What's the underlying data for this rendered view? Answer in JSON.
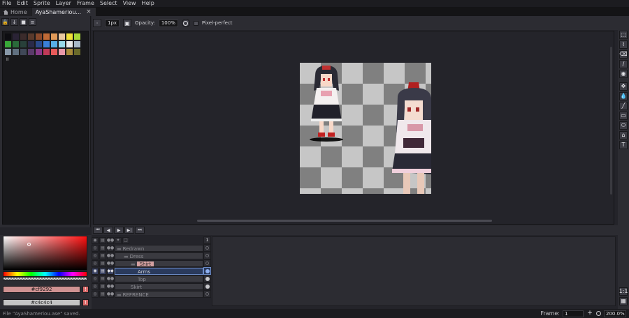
{
  "menu": [
    "File",
    "Edit",
    "Sprite",
    "Layer",
    "Frame",
    "Select",
    "View",
    "Help"
  ],
  "tabs": [
    {
      "label": "Home",
      "icon": "home-icon"
    },
    {
      "label": "AyaShameriou...",
      "close": "×"
    }
  ],
  "palette": {
    "colors": [
      "#0d0d11",
      "#2a2335",
      "#3b2b2b",
      "#5a3a2c",
      "#8a4a2c",
      "#c06a36",
      "#e09a58",
      "#e8c8a0",
      "#f0e038",
      "#a8d838",
      "#38a838",
      "#2a6a3a",
      "#28403a",
      "#2a2a48",
      "#2a4a8a",
      "#3a80d8",
      "#58b0e8",
      "#98d8e8",
      "#e8e8e8",
      "#a8b8c8",
      "#8898a8",
      "#607080",
      "#404858",
      "#5a3a6a",
      "#8a3a8a",
      "#c03a58",
      "#e85a5a",
      "#e898a8",
      "#a88a3a",
      "#6a6a2a"
    ],
    "extra_label": "II"
  },
  "context": {
    "brush_size": "1px",
    "opacity_label": "Opacity:",
    "opacity_value": "100%",
    "pixel_perfect_label": "Pixel-perfect"
  },
  "tools": [
    "⬚",
    "⌇",
    "⌫",
    "∕",
    "◉",
    "✥",
    "💧",
    "╱",
    "▭",
    "⬭",
    "⌂",
    "T"
  ],
  "tool_names": [
    "rectangular-marquee-icon",
    "lasso-icon",
    "eraser-icon",
    "pencil-icon",
    "spray-icon",
    "move-icon",
    "eyedropper-icon",
    "line-icon",
    "rectangle-icon",
    "ellipse-icon",
    "blur-icon",
    "text-icon"
  ],
  "timeline": {
    "buttons": [
      "⏮",
      "◀",
      "▶",
      "▶|",
      "⏭"
    ],
    "frame_header": "1"
  },
  "layers": [
    {
      "name": "Redrawn",
      "indent": 0,
      "type": "group",
      "cel": "empty"
    },
    {
      "name": "Dress",
      "indent": 10,
      "type": "group",
      "cel": "empty"
    },
    {
      "name": "Shirt",
      "indent": 20,
      "type": "group",
      "cel": "empty",
      "highlight": true
    },
    {
      "name": "Arms",
      "indent": 30,
      "type": "layer",
      "cel": "filled",
      "active": true
    },
    {
      "name": "Top",
      "indent": 30,
      "type": "layer",
      "cel": "filled"
    },
    {
      "name": "Skirt",
      "indent": 20,
      "type": "layer",
      "cel": "filled"
    },
    {
      "name": "REFRENCE",
      "indent": 0,
      "type": "group",
      "cel": "empty"
    }
  ],
  "colors": {
    "foreground_hex": "#cf9292",
    "background_hex": "#c4c4c4",
    "foreground_label": "#cf9292",
    "background_label": "#c4c4c4",
    "warn": "!"
  },
  "status": {
    "message": "File \"AyaShameriou.ase\" saved.",
    "frame_label": "Frame:",
    "frame_value": "1",
    "plus": "+",
    "zoom": "200.0%"
  }
}
